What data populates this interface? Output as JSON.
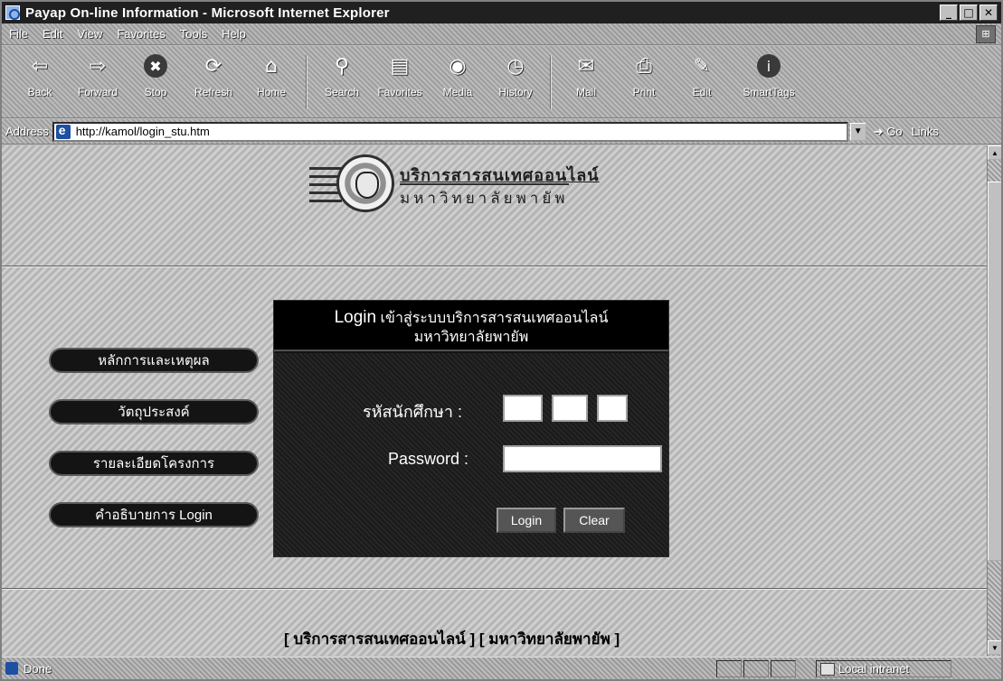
{
  "window": {
    "title": "Payap On-line Information - Microsoft Internet Explorer",
    "controls": {
      "minimize": "_",
      "maximize": "□",
      "close": "✕"
    }
  },
  "menu": [
    "File",
    "Edit",
    "View",
    "Favorites",
    "Tools",
    "Help"
  ],
  "toolbar": {
    "back": {
      "label": "Back",
      "icon": "⇦"
    },
    "forward": {
      "label": "Forward",
      "icon": "⇨"
    },
    "stop": {
      "label": "Stop",
      "icon": "✖"
    },
    "refresh": {
      "label": "Refresh",
      "icon": "⟳"
    },
    "home": {
      "label": "Home",
      "icon": "⌂"
    },
    "search": {
      "label": "Search",
      "icon": "⚲"
    },
    "favorites": {
      "label": "Favorites",
      "icon": "▤"
    },
    "media": {
      "label": "Media",
      "icon": "◉"
    },
    "history": {
      "label": "History",
      "icon": "◷"
    },
    "mail": {
      "label": "Mail",
      "icon": "✉"
    },
    "print": {
      "label": "Print",
      "icon": "⎙"
    },
    "edit": {
      "label": "Edit",
      "icon": "✎"
    },
    "smarttags": {
      "label": "SmartTags",
      "icon": "i"
    }
  },
  "address": {
    "label": "Address",
    "url": "http://kamol/login_stu.htm",
    "go": "Go",
    "links": "Links"
  },
  "banner": {
    "line1": "บริการสารสนเทศออนไลน์",
    "line2": "มหาวิทยาลัยพายัพ"
  },
  "side_menu": [
    "หลักการและเหตุผล",
    "วัตถุประสงค์",
    "รายละเอียดโครงการ",
    "คำอธิบายการ Login"
  ],
  "login_panel": {
    "title_bold": "Login",
    "title_rest": " เข้าสู่ระบบบริการสารสนเทศออนไลน์",
    "title_line2": "มหาวิทยาลัยพายัพ",
    "student_id_label": "รหัสนักศึกษา :",
    "student_id_parts": [
      "",
      "",
      ""
    ],
    "password_label": "Password :",
    "password_value": "",
    "login_button": "Login",
    "clear_button": "Clear"
  },
  "footer": "[ บริการสารสนเทศออนไลน์ ] [ มหาวิทยาลัยพายัพ ]",
  "status": {
    "text": "Done",
    "zone": "Local intranet"
  }
}
